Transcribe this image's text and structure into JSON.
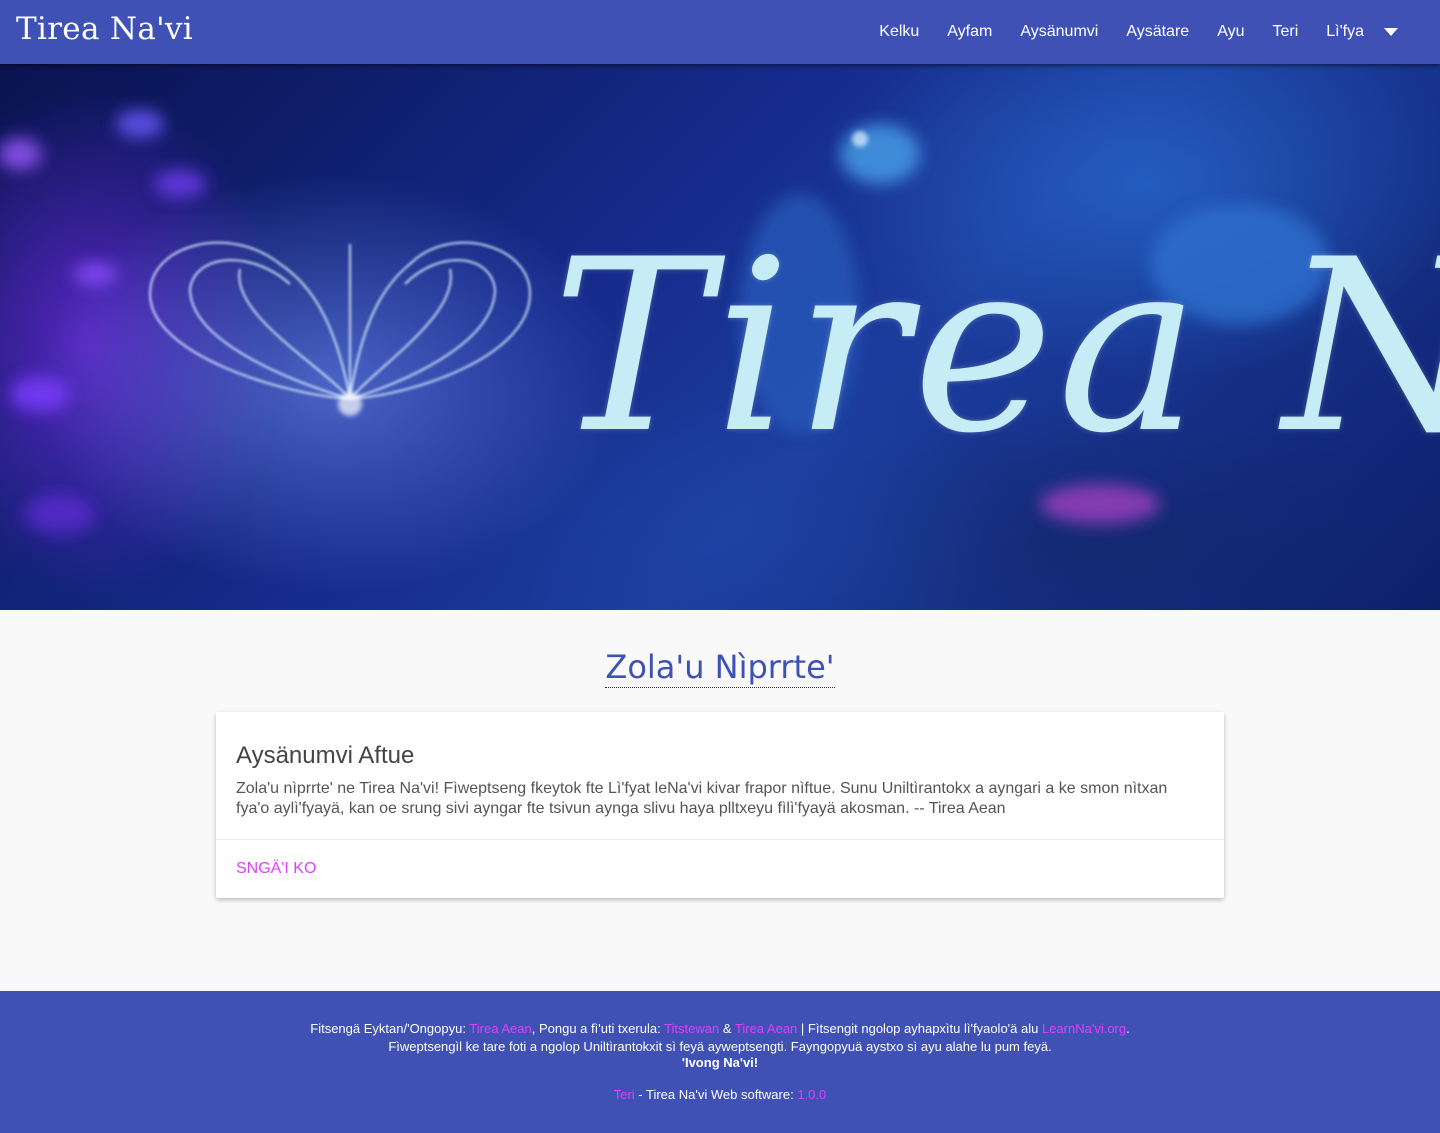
{
  "navbar": {
    "brand": "Tirea Na'vi",
    "items": [
      {
        "label": "Kelku"
      },
      {
        "label": "Ayfam"
      },
      {
        "label": "Aysänumvi"
      },
      {
        "label": "Aysätare"
      },
      {
        "label": "Ayu"
      },
      {
        "label": "Teri"
      }
    ],
    "dropdown_label": "Lì'fya",
    "dropdown_icon": "caret-down-icon",
    "background": "#3f51b5"
  },
  "hero": {
    "title": "Tirea Na'vi",
    "title_color": "#c6ecf5"
  },
  "main": {
    "section_title": "Zola'u Nìprrte'",
    "section_title_color": "#3f51b5",
    "card": {
      "title": "Aysänumvi Aftue",
      "text": "Zola'u nìprrte' ne Tirea Na'vi! Fìweptseng fkeytok fte Lì'fyat leNa'vi kivar frapor nìftue. Sunu Uniltìrantokx a ayngari a ke smon nìtxan fya'o aylì'fyayä, kan oe srung sivi ayngar fte tsivun aynga slivu haya plltxeyu fìlì'fyayä akosman. -- Tirea Aean",
      "action": "Sngä'i ko",
      "action_color": "#e040fb"
    }
  },
  "footer": {
    "line1": {
      "prefix": "Fitsengä Eyktan/'Ongopyu: ",
      "link1": "Tirea Aean",
      "mid1": ", Pongu a fì'uti txerula: ",
      "link2": "Titstewan",
      "amp": " & ",
      "link3": "Tirea Aean",
      "mid2": " | Fìtsengit ngolop ayhapxìtu lì'fyaolo'ä alu ",
      "link4": "LearnNa'vi.org",
      "suffix": "."
    },
    "line2": "Fìweptsengìl ke tare foti a ngolop Uniltìrantokxit sì feyä ayweptsengti. Fayngopyuä aystxo sì ayu alahe lu pum feyä.",
    "line3": "'Ivong Na'vi!",
    "line4": {
      "link": "Teri",
      "text": " - Tirea Na'vi Web software: ",
      "version": "1.0.0"
    },
    "link_color": "#e040fb"
  }
}
